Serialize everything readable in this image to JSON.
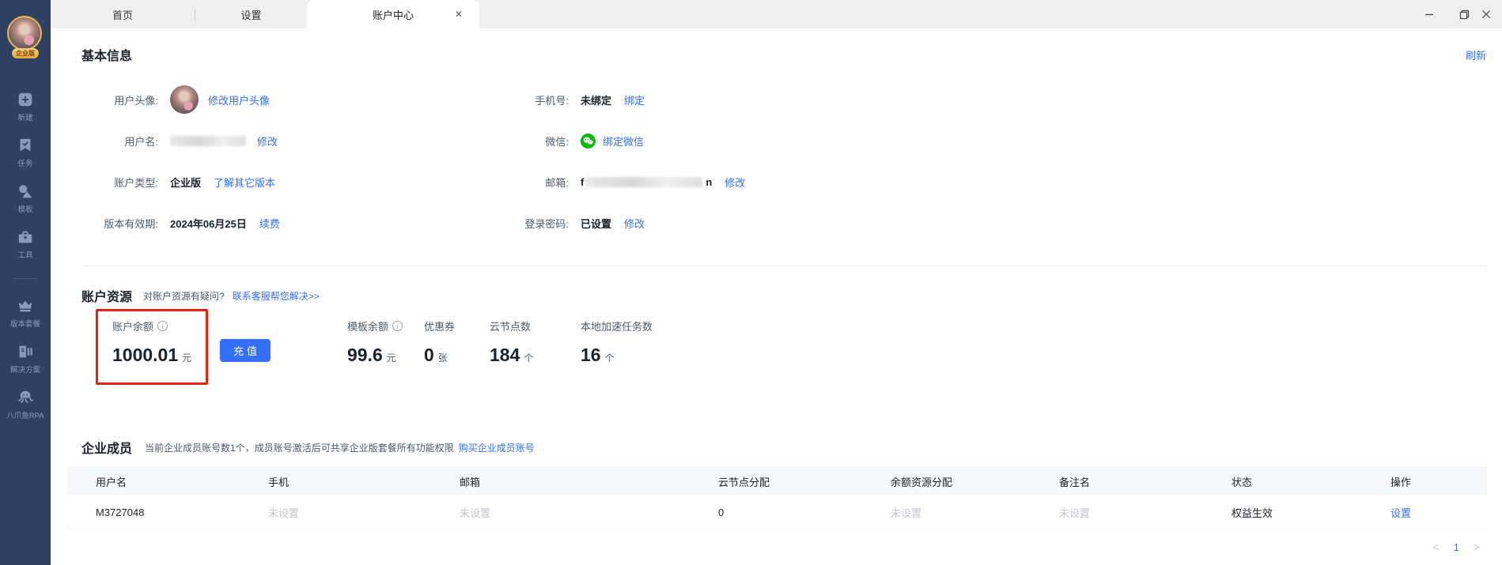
{
  "tabs": [
    {
      "label": "首页"
    },
    {
      "label": "设置"
    },
    {
      "label": "账户中心",
      "close_glyph": "✕"
    }
  ],
  "sidebar": {
    "badge": "企业版",
    "items": [
      {
        "icon": "plus-square-icon",
        "label": "新建"
      },
      {
        "icon": "bookmark-check-icon",
        "label": "任务"
      },
      {
        "icon": "shapes-icon",
        "label": "模板"
      },
      {
        "icon": "briefcase-icon",
        "label": "工具"
      },
      {
        "icon": "crown-icon",
        "label": "版本套餐"
      },
      {
        "icon": "solution-doc-icon",
        "label": "解决方案"
      },
      {
        "icon": "octopus-icon",
        "label": "八爪鱼RPA"
      }
    ]
  },
  "basic_info": {
    "title": "基本信息",
    "refresh": "刷新",
    "rows_left": [
      {
        "label": "用户头像:",
        "link": "修改用户头像"
      },
      {
        "label": "用户名:",
        "link": "修改"
      },
      {
        "label": "账户类型:",
        "value": "企业版",
        "link": "了解其它版本"
      },
      {
        "label": "版本有效期:",
        "value": "2024年06月25日",
        "link": "续费"
      }
    ],
    "rows_right": [
      {
        "label": "手机号:",
        "value": "未绑定",
        "link": "绑定"
      },
      {
        "label": "微信:",
        "link": "绑定微信"
      },
      {
        "label": "邮箱:",
        "value_prefix": "f",
        "value_suffix": "n",
        "link": "修改"
      },
      {
        "label": "登录密码:",
        "value": "已设置",
        "link": "修改"
      }
    ]
  },
  "resources": {
    "title": "账户资源",
    "question": "对账户资源有疑问?",
    "help_link": "联系客服帮您解决>>",
    "recharge_button": "充值",
    "items": [
      {
        "label": "账户余额",
        "value": "1000.01",
        "unit": "元",
        "highlighted": true
      },
      {
        "label": "模板余额",
        "value": "99.6",
        "unit": "元"
      },
      {
        "label": "优惠券",
        "value": "0",
        "unit": "张"
      },
      {
        "label": "云节点数",
        "value": "184",
        "unit": "个"
      },
      {
        "label": "本地加速任务数",
        "value": "16",
        "unit": "个"
      }
    ]
  },
  "members": {
    "title": "企业成员",
    "note": "当前企业成员账号数1个，成员账号激活后可共享企业版套餐所有功能权限",
    "buy_link": "购买企业成员账号",
    "table": {
      "columns": [
        "用户名",
        "手机",
        "邮箱",
        "云节点分配",
        "余额资源分配",
        "备注名",
        "状态",
        "操作"
      ],
      "rows": [
        {
          "username": "M3727048",
          "phone": "未设置",
          "email": "未设置",
          "cloud_nodes": "0",
          "balance_alloc": "未设置",
          "remark": "未设置",
          "status": "权益生效",
          "action": "设置"
        }
      ]
    },
    "pagination": {
      "prev": "<",
      "page": "1",
      "next": ">"
    }
  },
  "icons": {
    "info": "i"
  },
  "colors": {
    "accent_blue": "#3370FF",
    "sidebar_navy": "#2F4163",
    "highlight_red": "#E8220E",
    "wechat_green": "#09BB07",
    "topbar_gray": "#F0F0F0"
  }
}
